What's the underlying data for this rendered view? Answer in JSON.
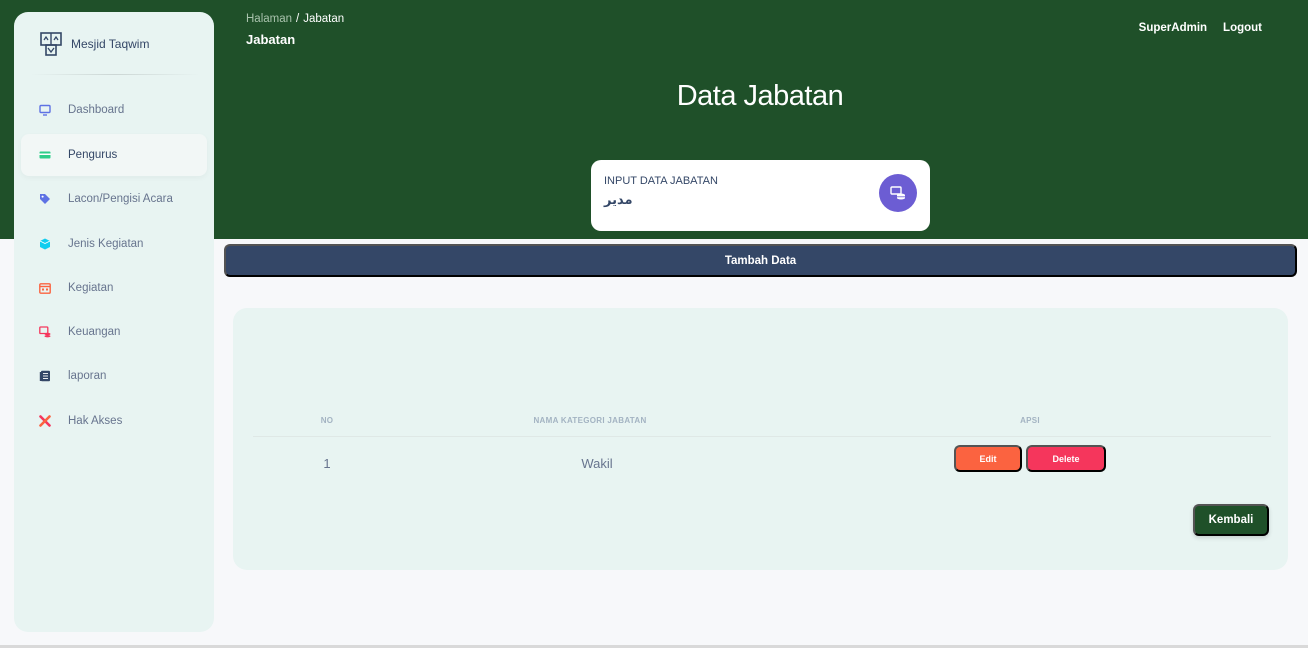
{
  "brand": {
    "name": "Mesjid Taqwim",
    "icon": "mosque-logo-icon"
  },
  "sidebar": {
    "items": [
      {
        "label": "Dashboard",
        "icon": "monitor-icon",
        "color": "#5e72e4"
      },
      {
        "label": "Pengurus",
        "icon": "card-icon",
        "color": "#2dce89",
        "active": true
      },
      {
        "label": "Lacon/Pengisi Acara",
        "icon": "tag-icon",
        "color": "#5e72e4"
      },
      {
        "label": "Jenis Kegiatan",
        "icon": "box-icon",
        "color": "#11cdef"
      },
      {
        "label": "Kegiatan",
        "icon": "calendar-icon",
        "color": "#fb6340"
      },
      {
        "label": "Keuangan",
        "icon": "money-icon",
        "color": "#f5365c"
      },
      {
        "label": "laporan",
        "icon": "document-icon",
        "color": "#344767"
      },
      {
        "label": "Hak Akses",
        "icon": "tools-icon",
        "color": "#f5365c"
      }
    ]
  },
  "header": {
    "breadcrumb": {
      "root": "Halaman",
      "separator": "/",
      "current": "Jabatan"
    },
    "title": "Jabatan",
    "nav": {
      "user": "SuperAdmin",
      "logout": "Logout"
    }
  },
  "hero": {
    "title": "Data Jabatan"
  },
  "input_card": {
    "label": "INPUT DATA JABATAN",
    "value": "مدير",
    "icon": "database-icon"
  },
  "actions": {
    "add_label": "Tambah Data",
    "back_label": "Kembali"
  },
  "table": {
    "columns": [
      "NO",
      "NAMA KATEGORI JABATAN",
      "APSI"
    ],
    "rows": [
      {
        "no": "1",
        "name": "Wakil",
        "edit_label": "Edit",
        "delete_label": "Delete"
      }
    ]
  },
  "colors": {
    "primary_green": "#1f5029",
    "navy": "#344767",
    "edit": "#fb6340",
    "delete": "#f5365c",
    "accent_purple": "#6c5dd3"
  }
}
